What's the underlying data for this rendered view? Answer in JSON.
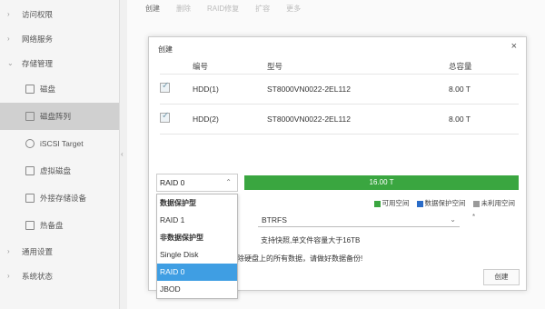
{
  "sidebar": {
    "items": [
      {
        "label": "访问权限"
      },
      {
        "label": "网络服务"
      },
      {
        "label": "存储管理"
      },
      {
        "label": "磁盘"
      },
      {
        "label": "磁盘阵列"
      },
      {
        "label": "iSCSI Target"
      },
      {
        "label": "虚拟磁盘"
      },
      {
        "label": "外接存储设备"
      },
      {
        "label": "热备盘"
      },
      {
        "label": "通用设置"
      },
      {
        "label": "系统状态"
      }
    ]
  },
  "tabs": [
    "创建",
    "删除",
    "RAID修复",
    "扩容",
    "更多"
  ],
  "modal": {
    "title": "创建",
    "close": "×",
    "columns": [
      "编号",
      "型号",
      "总容量"
    ],
    "disks": [
      {
        "id": "HDD(1)",
        "model": "ST8000VN0022-2EL112",
        "capacity": "8.00 T",
        "checked": true
      },
      {
        "id": "HDD(2)",
        "model": "ST8000VN0022-2EL112",
        "capacity": "8.00 T",
        "checked": true
      }
    ],
    "raid_value": "RAID 0",
    "capacity_label": "16.00 T",
    "legend": [
      {
        "label": "可用空间",
        "color": "#3aa640"
      },
      {
        "label": "数据保护空间",
        "color": "#2a6cc8"
      },
      {
        "label": "未利用空间",
        "color": "#9a9a9a"
      }
    ],
    "fs_value": "BTRFS",
    "fs_extra": "*",
    "fs_note": "支持快照,单文件容量大于16TB",
    "warning": "除硬盘上的所有数据，请做好数据备份!",
    "create_button": "创建"
  },
  "dropdown": {
    "items": [
      {
        "label": "数据保护型",
        "group": true
      },
      {
        "label": "RAID 1",
        "group": false
      },
      {
        "label": "非数据保护型",
        "group": true
      },
      {
        "label": "Single Disk",
        "group": false
      },
      {
        "label": "RAID 0",
        "group": false,
        "selected": true
      },
      {
        "label": "JBOD",
        "group": false
      }
    ]
  }
}
